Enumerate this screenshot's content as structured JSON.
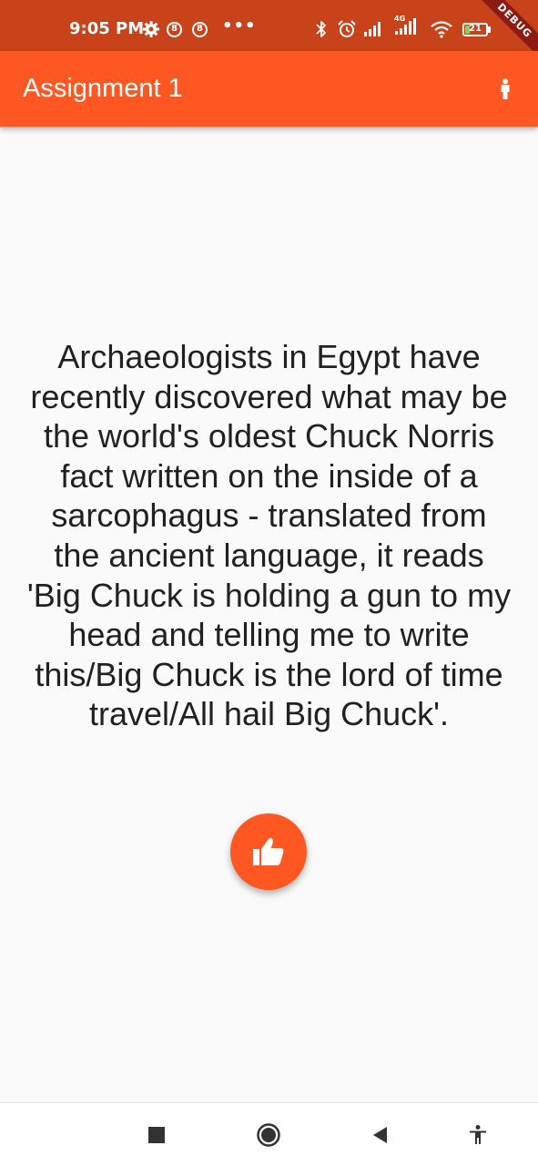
{
  "status_bar": {
    "time": "9:05 PM",
    "battery_level": "21",
    "battery_fraction": 0.21,
    "notification_badge_text": "8",
    "more_indicator": "•••",
    "network_label": "4G",
    "icons": [
      "gear-icon",
      "notification-badge-icon",
      "notification-badge-icon",
      "more-dots-icon",
      "bluetooth-icon",
      "alarm-icon",
      "signal-icon",
      "signal-4g-icon",
      "wifi-icon",
      "battery-icon"
    ]
  },
  "debug_banner": "DEBUG",
  "app_bar": {
    "title": "Assignment 1",
    "action_icon": "person-icon"
  },
  "main": {
    "fact": "Archaeologists in Egypt have recently discovered what may be the world's oldest Chuck Norris fact written on the inside of a sarcophagus - translated from the ancient language, it reads 'Big Chuck is holding a gun to my head and telling me to write this/Big Chuck is the lord of time travel/All hail Big Chuck'.",
    "like_button_icon": "thumb-up-icon"
  },
  "nav_bar": {
    "buttons": [
      "square-recents-icon",
      "circle-home-icon",
      "triangle-back-icon",
      "accessibility-icon"
    ]
  },
  "colors": {
    "status_bar": "#c8421a",
    "primary": "#ff5722",
    "background": "#fafafa",
    "text": "#212121",
    "debug_ribbon": "#8c1c13",
    "nav_bar": "#ffffff",
    "nav_icon": "#333333",
    "battery_fill": "#7ed957"
  }
}
